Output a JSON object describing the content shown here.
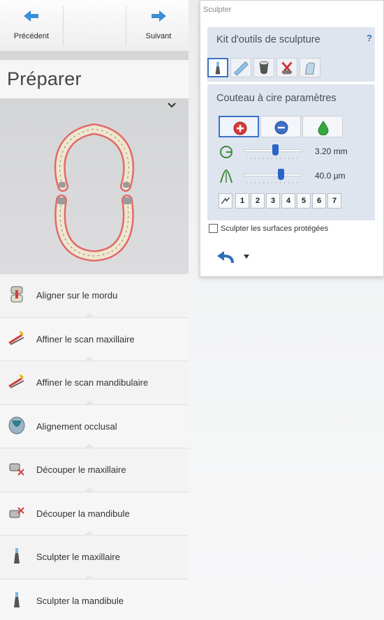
{
  "nav": {
    "previous_label": "Précédent",
    "next_label": "Suivant"
  },
  "panel": {
    "title": "Préparer"
  },
  "steps": [
    {
      "label": "Aligner sur le mordu",
      "icon": "bite-align-icon"
    },
    {
      "label": "Affiner le scan maxillaire",
      "icon": "refine-upper-icon"
    },
    {
      "label": "Affiner le scan mandibulaire",
      "icon": "refine-lower-icon"
    },
    {
      "label": "Alignement occlusal",
      "icon": "occlusal-icon"
    },
    {
      "label": "Découper le maxillaire",
      "icon": "cut-upper-icon"
    },
    {
      "label": "Découper la mandibule",
      "icon": "cut-lower-icon"
    },
    {
      "label": "Sculpter le maxillaire",
      "icon": "sculpt-upper-icon"
    },
    {
      "label": "Sculpter la mandibule",
      "icon": "sculpt-lower-icon"
    }
  ],
  "sculpter": {
    "window_title": "Sculpter",
    "toolkit_title": "Kit d'outils de sculpture",
    "help_label": "?",
    "tools": [
      "wax-knife-icon",
      "smooth-icon",
      "shape-icon",
      "delete-icon",
      "fill-icon"
    ],
    "params_title": "Couteau à cire paramètres",
    "modes": [
      "add-material-icon",
      "remove-material-icon",
      "smooth-drop-icon"
    ],
    "size_value": "3.20 mm",
    "size_level": 0.55,
    "depth_value": "40.0 µm",
    "depth_level": 0.65,
    "presets": [
      "1",
      "2",
      "3",
      "4",
      "5",
      "6",
      "7"
    ],
    "protect_label": "Sculpter les surfaces protégées"
  },
  "colors": {
    "accent": "#3b73c4",
    "nav_arrow": "#3a8fd6",
    "section_bg": "#dfe5ee"
  }
}
